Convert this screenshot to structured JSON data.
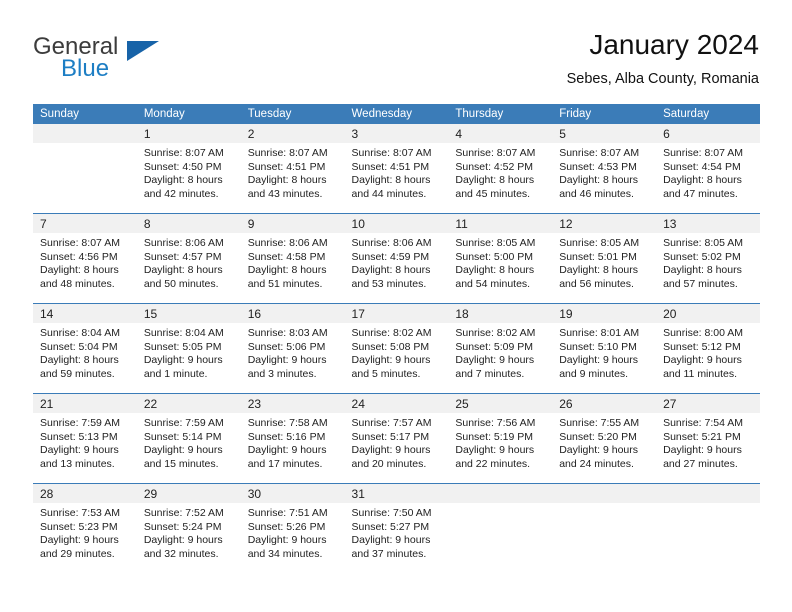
{
  "logo": {
    "word_one": "General",
    "word_two": "Blue",
    "triangle_color": "#1763a8",
    "blue_color": "#1d7ec4"
  },
  "header": {
    "title": "January 2024",
    "subtitle": "Sebes, Alba County, Romania"
  },
  "theme": {
    "header_blue": "#3b7cb8",
    "daynum_gray": "#f1f1f1"
  },
  "calendar": {
    "weekday_headers": [
      "Sunday",
      "Monday",
      "Tuesday",
      "Wednesday",
      "Thursday",
      "Friday",
      "Saturday"
    ],
    "weeks": [
      [
        {
          "day": "",
          "lines": []
        },
        {
          "day": "1",
          "lines": [
            "Sunrise: 8:07 AM",
            "Sunset: 4:50 PM",
            "Daylight: 8 hours",
            "and 42 minutes."
          ]
        },
        {
          "day": "2",
          "lines": [
            "Sunrise: 8:07 AM",
            "Sunset: 4:51 PM",
            "Daylight: 8 hours",
            "and 43 minutes."
          ]
        },
        {
          "day": "3",
          "lines": [
            "Sunrise: 8:07 AM",
            "Sunset: 4:51 PM",
            "Daylight: 8 hours",
            "and 44 minutes."
          ]
        },
        {
          "day": "4",
          "lines": [
            "Sunrise: 8:07 AM",
            "Sunset: 4:52 PM",
            "Daylight: 8 hours",
            "and 45 minutes."
          ]
        },
        {
          "day": "5",
          "lines": [
            "Sunrise: 8:07 AM",
            "Sunset: 4:53 PM",
            "Daylight: 8 hours",
            "and 46 minutes."
          ]
        },
        {
          "day": "6",
          "lines": [
            "Sunrise: 8:07 AM",
            "Sunset: 4:54 PM",
            "Daylight: 8 hours",
            "and 47 minutes."
          ]
        }
      ],
      [
        {
          "day": "7",
          "lines": [
            "Sunrise: 8:07 AM",
            "Sunset: 4:56 PM",
            "Daylight: 8 hours",
            "and 48 minutes."
          ]
        },
        {
          "day": "8",
          "lines": [
            "Sunrise: 8:06 AM",
            "Sunset: 4:57 PM",
            "Daylight: 8 hours",
            "and 50 minutes."
          ]
        },
        {
          "day": "9",
          "lines": [
            "Sunrise: 8:06 AM",
            "Sunset: 4:58 PM",
            "Daylight: 8 hours",
            "and 51 minutes."
          ]
        },
        {
          "day": "10",
          "lines": [
            "Sunrise: 8:06 AM",
            "Sunset: 4:59 PM",
            "Daylight: 8 hours",
            "and 53 minutes."
          ]
        },
        {
          "day": "11",
          "lines": [
            "Sunrise: 8:05 AM",
            "Sunset: 5:00 PM",
            "Daylight: 8 hours",
            "and 54 minutes."
          ]
        },
        {
          "day": "12",
          "lines": [
            "Sunrise: 8:05 AM",
            "Sunset: 5:01 PM",
            "Daylight: 8 hours",
            "and 56 minutes."
          ]
        },
        {
          "day": "13",
          "lines": [
            "Sunrise: 8:05 AM",
            "Sunset: 5:02 PM",
            "Daylight: 8 hours",
            "and 57 minutes."
          ]
        }
      ],
      [
        {
          "day": "14",
          "lines": [
            "Sunrise: 8:04 AM",
            "Sunset: 5:04 PM",
            "Daylight: 8 hours",
            "and 59 minutes."
          ]
        },
        {
          "day": "15",
          "lines": [
            "Sunrise: 8:04 AM",
            "Sunset: 5:05 PM",
            "Daylight: 9 hours",
            "and 1 minute."
          ]
        },
        {
          "day": "16",
          "lines": [
            "Sunrise: 8:03 AM",
            "Sunset: 5:06 PM",
            "Daylight: 9 hours",
            "and 3 minutes."
          ]
        },
        {
          "day": "17",
          "lines": [
            "Sunrise: 8:02 AM",
            "Sunset: 5:08 PM",
            "Daylight: 9 hours",
            "and 5 minutes."
          ]
        },
        {
          "day": "18",
          "lines": [
            "Sunrise: 8:02 AM",
            "Sunset: 5:09 PM",
            "Daylight: 9 hours",
            "and 7 minutes."
          ]
        },
        {
          "day": "19",
          "lines": [
            "Sunrise: 8:01 AM",
            "Sunset: 5:10 PM",
            "Daylight: 9 hours",
            "and 9 minutes."
          ]
        },
        {
          "day": "20",
          "lines": [
            "Sunrise: 8:00 AM",
            "Sunset: 5:12 PM",
            "Daylight: 9 hours",
            "and 11 minutes."
          ]
        }
      ],
      [
        {
          "day": "21",
          "lines": [
            "Sunrise: 7:59 AM",
            "Sunset: 5:13 PM",
            "Daylight: 9 hours",
            "and 13 minutes."
          ]
        },
        {
          "day": "22",
          "lines": [
            "Sunrise: 7:59 AM",
            "Sunset: 5:14 PM",
            "Daylight: 9 hours",
            "and 15 minutes."
          ]
        },
        {
          "day": "23",
          "lines": [
            "Sunrise: 7:58 AM",
            "Sunset: 5:16 PM",
            "Daylight: 9 hours",
            "and 17 minutes."
          ]
        },
        {
          "day": "24",
          "lines": [
            "Sunrise: 7:57 AM",
            "Sunset: 5:17 PM",
            "Daylight: 9 hours",
            "and 20 minutes."
          ]
        },
        {
          "day": "25",
          "lines": [
            "Sunrise: 7:56 AM",
            "Sunset: 5:19 PM",
            "Daylight: 9 hours",
            "and 22 minutes."
          ]
        },
        {
          "day": "26",
          "lines": [
            "Sunrise: 7:55 AM",
            "Sunset: 5:20 PM",
            "Daylight: 9 hours",
            "and 24 minutes."
          ]
        },
        {
          "day": "27",
          "lines": [
            "Sunrise: 7:54 AM",
            "Sunset: 5:21 PM",
            "Daylight: 9 hours",
            "and 27 minutes."
          ]
        }
      ],
      [
        {
          "day": "28",
          "lines": [
            "Sunrise: 7:53 AM",
            "Sunset: 5:23 PM",
            "Daylight: 9 hours",
            "and 29 minutes."
          ]
        },
        {
          "day": "29",
          "lines": [
            "Sunrise: 7:52 AM",
            "Sunset: 5:24 PM",
            "Daylight: 9 hours",
            "and 32 minutes."
          ]
        },
        {
          "day": "30",
          "lines": [
            "Sunrise: 7:51 AM",
            "Sunset: 5:26 PM",
            "Daylight: 9 hours",
            "and 34 minutes."
          ]
        },
        {
          "day": "31",
          "lines": [
            "Sunrise: 7:50 AM",
            "Sunset: 5:27 PM",
            "Daylight: 9 hours",
            "and 37 minutes."
          ]
        },
        {
          "day": "",
          "lines": []
        },
        {
          "day": "",
          "lines": []
        },
        {
          "day": "",
          "lines": []
        }
      ]
    ]
  }
}
